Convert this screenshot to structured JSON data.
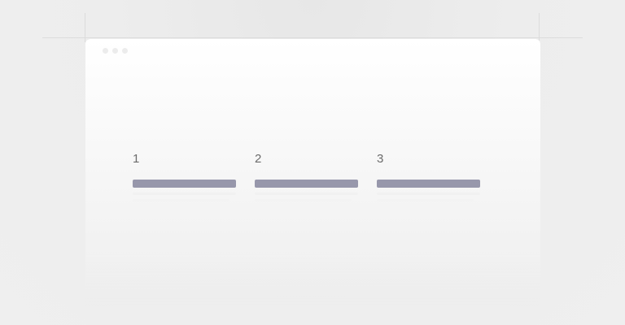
{
  "window": {
    "controls": [
      "close",
      "minimize",
      "maximize"
    ]
  },
  "steps": [
    {
      "number": "1"
    },
    {
      "number": "2"
    },
    {
      "number": "3"
    }
  ],
  "colors": {
    "progress_bar": "#9797ab",
    "step_number": "#6b6b6b",
    "window_bg": "#ffffff",
    "page_bg": "#efefef"
  }
}
